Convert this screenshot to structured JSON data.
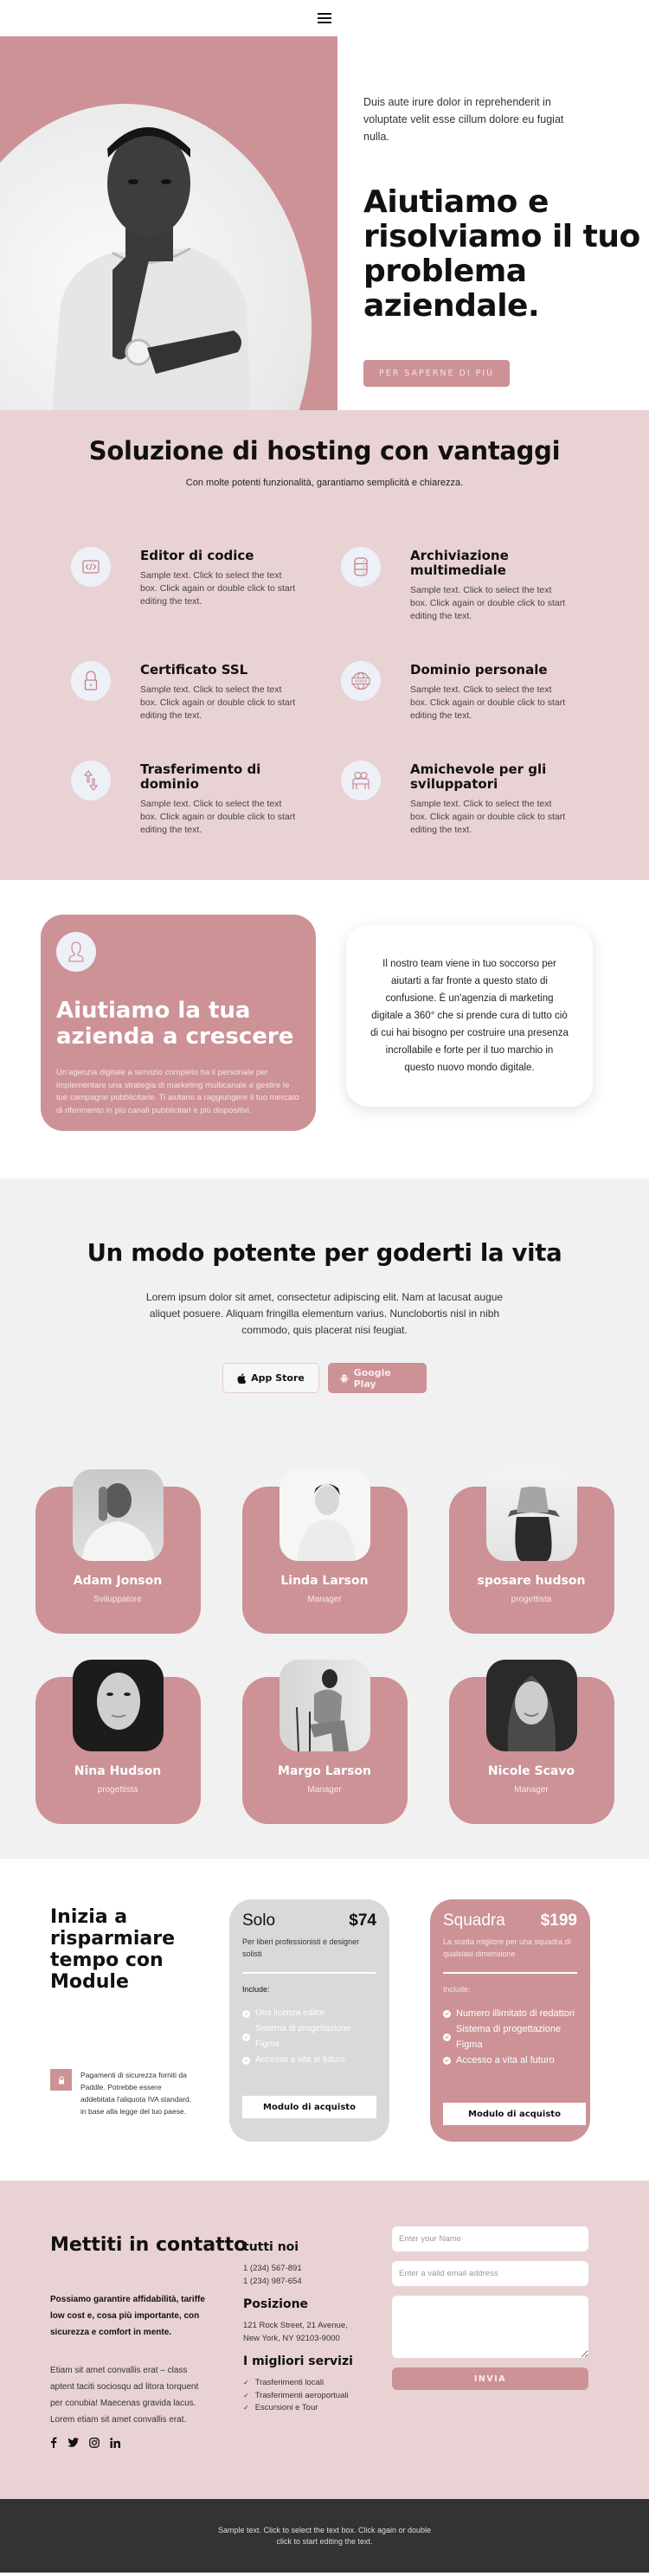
{
  "header": {
    "menu_icon": "hamburger-menu-icon"
  },
  "hero": {
    "lead": "Duis aute irure dolor in reprehenderit in voluptate velit esse cillum dolore eu fugiat nulla.",
    "title": "Aiutiamo e risolviamo il tuo problema aziendale.",
    "button": "PER SAPERNE DI PIÙ"
  },
  "features": {
    "title": "Soluzione di hosting con vantaggi",
    "subtitle": "Con molte potenti funzionalità, garantiamo semplicità e chiarezza.",
    "items": [
      {
        "icon": "code-icon",
        "title": "Editor di codice",
        "text": "Sample text. Click to select the text box. Click again or double click to start editing the text."
      },
      {
        "icon": "database-icon",
        "title": "Archiviazione multimediale",
        "text": "Sample text. Click to select the text box. Click again or double click to start editing the text."
      },
      {
        "icon": "lock-icon",
        "title": "Certificato SSL",
        "text": "Sample text. Click to select the text box. Click again or double click to start editing the text."
      },
      {
        "icon": "globe-www-icon",
        "title": "Dominio personale",
        "text": "Sample text. Click to select the text box. Click again or double click to start editing the text."
      },
      {
        "icon": "transfer-arrows-icon",
        "title": "Trasferimento di dominio",
        "text": "Sample text. Click to select the text box. Click again or double click to start editing the text."
      },
      {
        "icon": "developers-icon",
        "title": "Amichevole per gli sviluppatori",
        "text": "Sample text. Click to select the text box. Click again or double click to start editing the text."
      }
    ]
  },
  "grow": {
    "icon": "user-icon",
    "title": "Aiutiamo la tua azienda a crescere",
    "text": "Un'agenzia digitale a servizio completo ha il personale per implementare una strategia di marketing multicanale e gestire le tue campagne pubblicitarie. Ti aiutano a raggiungere il tuo mercato di riferimento in più canali pubblicitari e più dispositivi.",
    "quote": "Il nostro team viene in tuo soccorso per aiutarti a far fronte a questo stato di confusione. È un'agenzia di marketing digitale a 360° che si prende cura di tutto ciò di cui hai bisogno per costruire una presenza incrollabile e forte per il tuo marchio in questo nuovo mondo digitale."
  },
  "app": {
    "title": "Un modo potente per goderti la vita",
    "text": "Lorem ipsum dolor sit amet, consectetur adipiscing elit. Nam at lacusat augue aliquet posuere. Aliquam fringilla elementum varius. Nunclobortis nisl in nibh commodo, quis placerat nisi feugiat.",
    "app_store": "App Store",
    "google_play": "Google Play"
  },
  "team": [
    {
      "name": "Adam Jonson",
      "role": "Sviluppatore"
    },
    {
      "name": "Linda Larson",
      "role": "Manager"
    },
    {
      "name": "sposare hudson",
      "role": "progettista"
    },
    {
      "name": "Nina Hudson",
      "role": "progettista"
    },
    {
      "name": "Margo Larson",
      "role": "Manager"
    },
    {
      "name": "Nicole Scavo",
      "role": "Manager"
    }
  ],
  "pricing": {
    "title": "Inizia a risparmiare tempo con Module",
    "secure_text": "Pagamenti di sicurezza forniti da Paddle. Potrebbe essere addebitata l'aliquota IVA standard, in base alla legge del tuo paese.",
    "plans": [
      {
        "name": "Solo",
        "price": "$74",
        "desc": "Per liberi professionisti e designer solisti",
        "include": "Include:",
        "features": [
          "Una licenza editor",
          "Sistema di progettazione Figma",
          "Accesso a vita al futuro"
        ],
        "button": "Modulo di acquisto"
      },
      {
        "name": "Squadra",
        "price": "$199",
        "desc": "La scelta migliore per una squadra di qualsiasi dimensione",
        "include": "Include:",
        "features": [
          "Numero illimitato di redattori",
          "Sistema di progettazione Figma",
          "Accesso a vita al futuro"
        ],
        "button": "Modulo di acquisto"
      }
    ]
  },
  "contact": {
    "title": "Mettiti in contatto",
    "bold": "Possiamo garantire affidabilità, tariffe low cost e, cosa più importante, con sicurezza e comfort in mente.",
    "text": "Etiam sit amet convallis erat – class aptent taciti sociosqu ad litora torquent per conubia! Maecenas gravida lacus. Lorem etiam sit amet convallis erat.",
    "social": [
      "facebook-icon",
      "twitter-icon",
      "instagram-icon",
      "linkedin-icon"
    ],
    "phones_title": "tutti noi",
    "phone1": "1 (234) 567-891",
    "phone2": "1 (234) 987-654",
    "location_title": "Posizione",
    "address1": "121 Rock Street, 21 Avenue,",
    "address2": "New York, NY 92103-9000",
    "services_title": "I migliori servizi",
    "services": [
      "Trasferimenti locali",
      "Trasferimenti aeroportuali",
      "Escursioni e Tour"
    ],
    "form": {
      "name_placeholder": "Enter your Name",
      "email_placeholder": "Enter a valid email address",
      "message_value": "",
      "submit": "INVIA"
    }
  },
  "footer": {
    "text": "Sample text. Click to select the text box. Click again or double click to start editing the text."
  },
  "colors": {
    "accent": "#cc9296",
    "light_pink": "#e9d2d3",
    "icon_bg": "#eef0f7",
    "gray_bg": "#f1f1f1",
    "footer_bg": "#333333"
  }
}
